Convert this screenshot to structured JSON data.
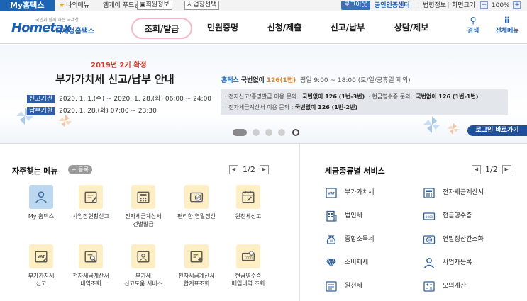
{
  "topbar": {
    "my_hometax": "My홈택스",
    "my_menu": "나의메뉴",
    "user_name": "엠케이 푸드님",
    "member_info": "회원정보",
    "business_select": "사업장선택",
    "logout": "로그아웃",
    "cert_center": "공인인증센터",
    "legal_info": "법령정보",
    "screen_size": "화면크기",
    "zoom_minus": "−",
    "zoom_value": "100%",
    "zoom_plus": "+"
  },
  "header": {
    "logo_small": "국민과 함께 하는 국세청",
    "logo_main": "Hometax",
    "logo_sub": "국세청홈택스",
    "nav": [
      {
        "label": "조회/발급",
        "active": true
      },
      {
        "label": "민원증명",
        "active": false
      },
      {
        "label": "신청/제출",
        "active": false
      },
      {
        "label": "신고/납부",
        "active": false
      },
      {
        "label": "상담/제보",
        "active": false
      }
    ],
    "search": "검색",
    "all_menu": "전체메뉴"
  },
  "banner": {
    "subtitle": "2019년 2기 확정",
    "title": "부가가치세 신고/납부 안내",
    "rows": [
      {
        "tag": "신고기간",
        "text": "2020. 1. 1.(수) ~ 2020. 1. 28.(화) 06:00 ~ 24:00"
      },
      {
        "tag": "납부기한",
        "text": "2020. 1. 28.(화) 07:00 ~ 23:30"
      }
    ],
    "hotline_a": "홈택스",
    "hotline_b": "국번없이",
    "hotline_c": "126(1번)",
    "hotline_d": "평일 9:00 ~ 18:00 (토/일/공휴일 제외)",
    "box_line1a": "· 전자신고/증명발급 이용 문의 : ",
    "box_line1b": "국번없이 126 (1번-3번)",
    "box_line1c": "· 현금영수증 문의 : ",
    "box_line1d": "국번없이 126 (1번-1번)",
    "box_line2a": "· 전자세금계산서 이용 문의 : ",
    "box_line2b": "국번없이 126 (1번-2번)",
    "login_shortcut": "로그인 바로가기",
    "slide_current": 1,
    "slide_count": 4
  },
  "frequent": {
    "title": "자주찾는 메뉴",
    "register": "+ 등록",
    "page": "1/2",
    "items": [
      {
        "label": "My 홈택스",
        "icon": "person-icon"
      },
      {
        "label": "사업장현황신고",
        "icon": "pen-document-icon"
      },
      {
        "label": "전자세금계산서\n건별발급",
        "icon": "calculator-icon"
      },
      {
        "label": "편리한 연말정산",
        "icon": "won-card-icon"
      },
      {
        "label": "원천세신고",
        "icon": "calendar-pen-icon"
      },
      {
        "label": "부가가치세\n신고",
        "icon": "vat-pen-icon"
      },
      {
        "label": "전자세금계산서\n내역조회",
        "icon": "search-document-icon"
      },
      {
        "label": "부가세\n신고도움 서비스",
        "icon": "person-card-icon"
      },
      {
        "label": "전자세금계산서\n합계표조회",
        "icon": "document-plus-icon"
      },
      {
        "label": "현금영수증\n매입내역 조회",
        "icon": "bill-search-icon"
      }
    ]
  },
  "tax_services": {
    "title": "세금종류별 서비스",
    "page": "1/2",
    "items": [
      {
        "label": "부가가치세",
        "icon": "vat-icon"
      },
      {
        "label": "전자세금계산서",
        "icon": "calculator-icon"
      },
      {
        "label": "법인세",
        "icon": "building-icon"
      },
      {
        "label": "현금영수증",
        "icon": "cash-receipt-icon"
      },
      {
        "label": "종합소득세",
        "icon": "money-bag-icon"
      },
      {
        "label": "연말정산간소화",
        "icon": "won-coin-icon"
      },
      {
        "label": "소비제세",
        "icon": "diamond-icon"
      },
      {
        "label": "사업자등록",
        "icon": "person-icon"
      },
      {
        "label": "원천세",
        "icon": "document-list-icon"
      },
      {
        "label": "모의계산",
        "icon": "calculator-plus-icon"
      }
    ]
  },
  "colors": {
    "brand_blue": "#1e5fae",
    "accent_red": "#d03a2c",
    "icon_yellow": "#fdeec4",
    "icon_blue": "#bcd8f1"
  }
}
